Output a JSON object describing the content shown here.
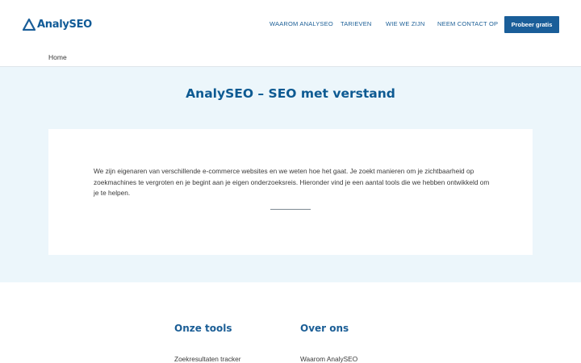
{
  "header": {
    "logo_text": "AnalySEO",
    "nav": [
      {
        "label": "WAAROM ANALYSEO"
      },
      {
        "label": "TARIEVEN"
      },
      {
        "label": "WIE WE ZIJN"
      },
      {
        "label": "NEEM CONTACT OP"
      }
    ],
    "cta_label": "Probeer gratis"
  },
  "breadcrumb": {
    "home": "Home"
  },
  "hero": {
    "title": "AnalySEO – SEO met verstand",
    "intro": "We zijn eigenaren van verschillende e-commerce websites en we weten hoe het gaat. Je zoekt manieren om je zichtbaarheid op zoekmachines te vergroten en je begint aan je eigen onderzoeksreis. Hieronder vind je een aantal tools die we hebben ontwikkeld om je te helpen."
  },
  "footer": {
    "columns": [
      {
        "heading": "Onze tools",
        "links": [
          "Zoekresultaten tracker"
        ]
      },
      {
        "heading": "Over ons",
        "links": [
          "Waarom AnalySEO"
        ]
      }
    ]
  },
  "colors": {
    "brand": "#1a5e99",
    "hero_bg": "#ecf6fb",
    "text": "#3a3a3a"
  },
  "icons": {
    "logo": "triangle-logo-icon"
  }
}
